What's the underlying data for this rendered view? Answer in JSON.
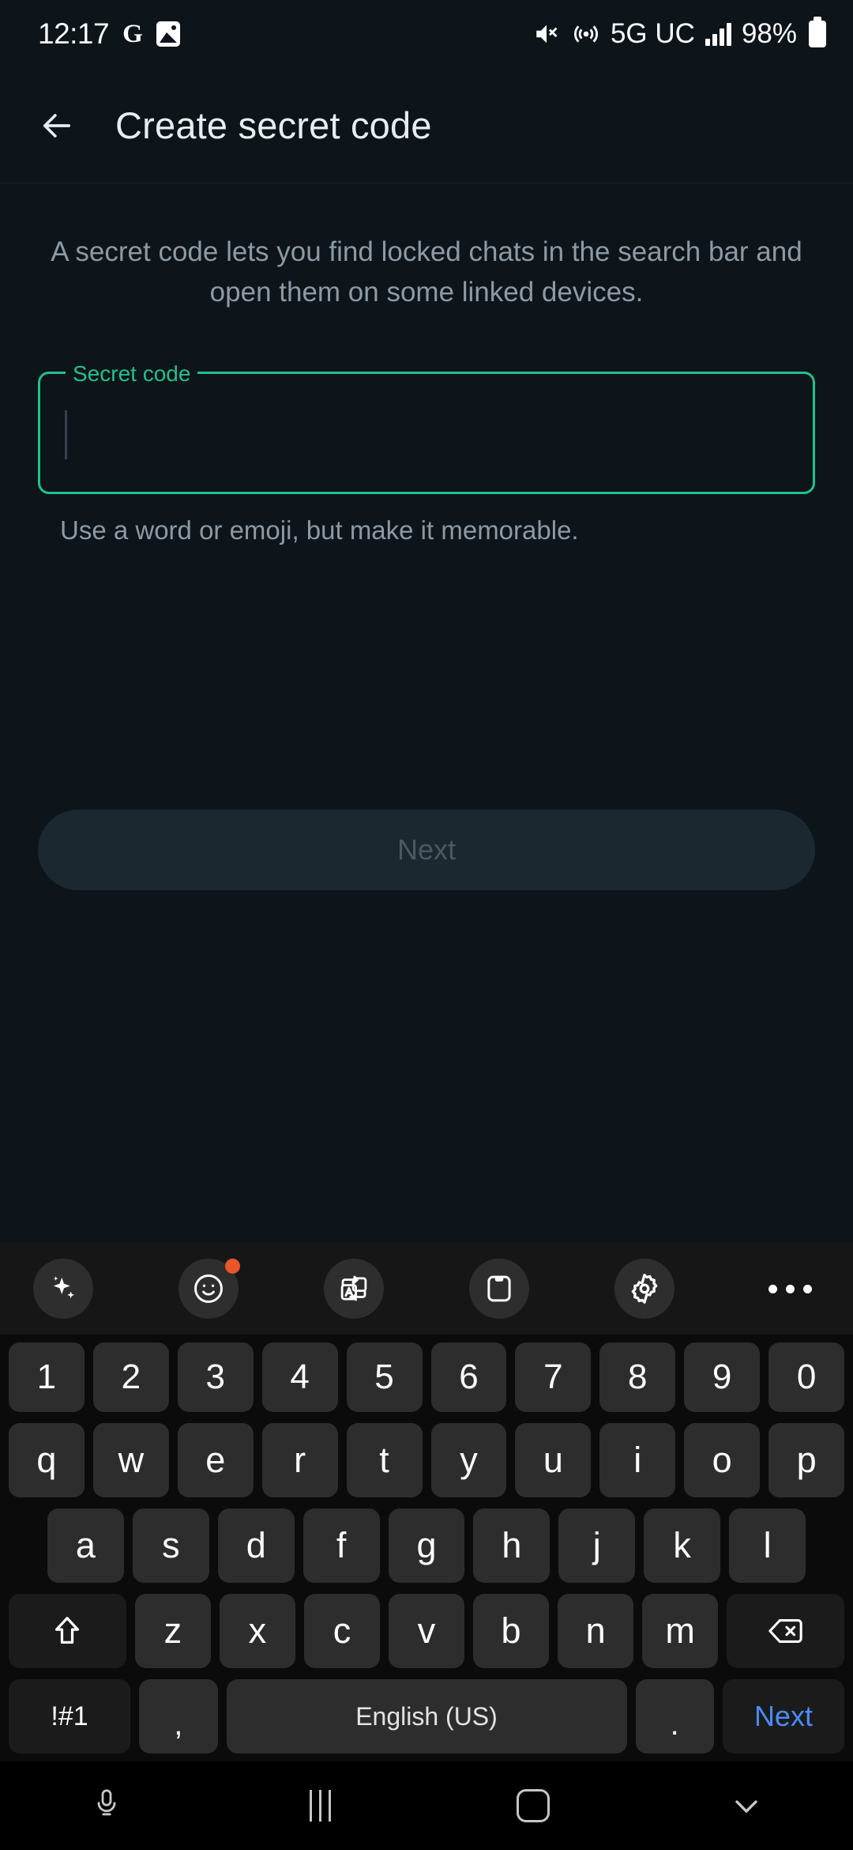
{
  "status_bar": {
    "clock": "12:17",
    "google_icon": "G",
    "photos_icon": "photos-icon",
    "mute_icon": "volume-mute-icon",
    "hotspot_icon": "hotspot-icon",
    "network": "5G UC",
    "signal_icon": "signal-bars-icon",
    "battery_percent": "98%",
    "battery_icon": "battery-full-icon"
  },
  "app_bar": {
    "back_icon": "arrow-left-icon",
    "title": "Create secret code"
  },
  "main": {
    "description": "A secret code lets you find locked chats in the search bar and open them on some linked devices.",
    "field": {
      "label": "Secret code",
      "value": "",
      "placeholder": ""
    },
    "helper_text": "Use a word or emoji, but make it memorable.",
    "next_button": "Next"
  },
  "keyboard": {
    "toolbar": [
      {
        "name": "ai-sparkle-icon",
        "badge": false
      },
      {
        "name": "emoji-icon",
        "badge": true
      },
      {
        "name": "translate-icon",
        "badge": false
      },
      {
        "name": "clipboard-icon",
        "badge": false
      },
      {
        "name": "settings-gear-icon",
        "badge": false
      },
      {
        "name": "more-options-icon",
        "badge": false
      }
    ],
    "rows": {
      "numbers": [
        "1",
        "2",
        "3",
        "4",
        "5",
        "6",
        "7",
        "8",
        "9",
        "0"
      ],
      "top": [
        "q",
        "w",
        "e",
        "r",
        "t",
        "y",
        "u",
        "i",
        "o",
        "p"
      ],
      "home": [
        "a",
        "s",
        "d",
        "f",
        "g",
        "h",
        "j",
        "k",
        "l"
      ],
      "bottom": [
        "z",
        "x",
        "c",
        "v",
        "b",
        "n",
        "m"
      ]
    },
    "shift_icon": "shift-up-icon",
    "backspace_icon": "backspace-icon",
    "symbols_key": "!#1",
    "comma_key": ",",
    "space_key": "English (US)",
    "period_key": ".",
    "enter_key": "Next"
  },
  "nav_bar": {
    "mic_icon": "microphone-icon",
    "recents_icon": "recents-icon",
    "home_icon": "home-icon",
    "dismiss_keyboard_icon": "chevron-down-icon"
  },
  "colors": {
    "accent_green": "#21c08b",
    "enter_blue": "#4a8cf7",
    "badge_orange": "#e8562a",
    "app_background": "#0d141a"
  }
}
